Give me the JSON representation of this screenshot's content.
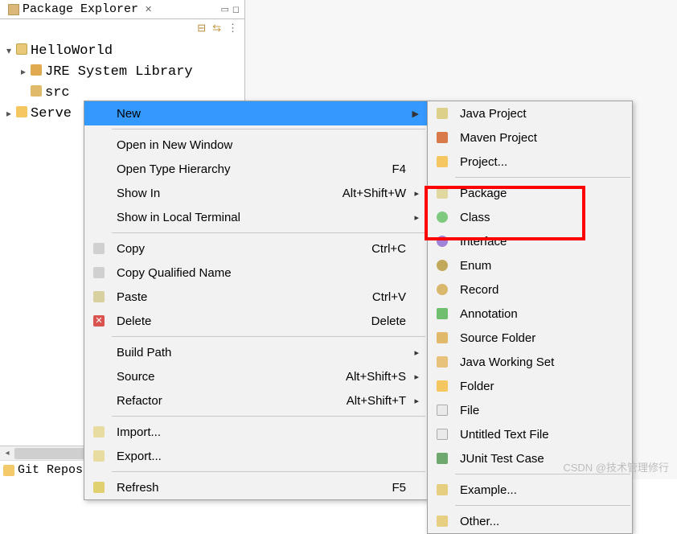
{
  "explorer": {
    "tab_title": "Package Explorer",
    "tree": {
      "project": "HelloWorld",
      "jre": "JRE System Library",
      "src": "src",
      "servers": "Serve"
    },
    "git_repos": "Git Repos"
  },
  "context_menu": {
    "new": "New",
    "open_new_window": "Open in New Window",
    "open_type_hierarchy": "Open Type Hierarchy",
    "show_in": "Show In",
    "show_local_terminal": "Show in Local Terminal",
    "copy": "Copy",
    "copy_qualified": "Copy Qualified Name",
    "paste": "Paste",
    "delete": "Delete",
    "build_path": "Build Path",
    "source": "Source",
    "refactor": "Refactor",
    "import": "Import...",
    "export": "Export...",
    "refresh": "Refresh",
    "shortcuts": {
      "f4": "F4",
      "alt_shift_w": "Alt+Shift+W",
      "ctrl_c": "Ctrl+C",
      "ctrl_v": "Ctrl+V",
      "delete": "Delete",
      "alt_shift_s": "Alt+Shift+S",
      "alt_shift_t": "Alt+Shift+T",
      "f5": "F5"
    }
  },
  "submenu": {
    "java_project": "Java Project",
    "maven_project": "Maven Project",
    "project": "Project...",
    "package": "Package",
    "class": "Class",
    "interface": "Interface",
    "enum": "Enum",
    "record": "Record",
    "annotation": "Annotation",
    "source_folder": "Source Folder",
    "java_working_set": "Java Working Set",
    "folder": "Folder",
    "file": "File",
    "untitled_text_file": "Untitled Text File",
    "junit_test_case": "JUnit Test Case",
    "example": "Example...",
    "other": "Other..."
  },
  "watermark": "CSDN @技术管理修行"
}
